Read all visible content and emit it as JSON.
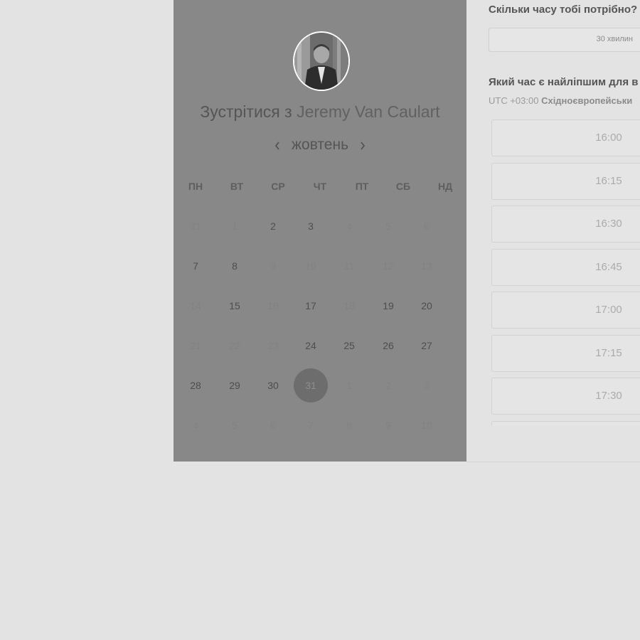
{
  "calendar": {
    "heading_prefix": "Зустрітися з",
    "host_name": "Jeremy Van Caulart",
    "month_label": "жовтень",
    "prev_icon": "chevron-left-icon",
    "next_icon": "chevron-right-icon",
    "weekdays": [
      "ПН",
      "ВТ",
      "СР",
      "ЧТ",
      "ПТ",
      "СБ",
      "НД"
    ],
    "weeks": [
      [
        {
          "d": "31",
          "on": false
        },
        {
          "d": "1",
          "on": false
        },
        {
          "d": "2",
          "on": true
        },
        {
          "d": "3",
          "on": true
        },
        {
          "d": "4",
          "on": false
        },
        {
          "d": "5",
          "on": false
        },
        {
          "d": "6",
          "on": false
        }
      ],
      [
        {
          "d": "7",
          "on": true
        },
        {
          "d": "8",
          "on": true
        },
        {
          "d": "9",
          "on": false
        },
        {
          "d": "10",
          "on": false
        },
        {
          "d": "11",
          "on": false
        },
        {
          "d": "12",
          "on": false
        },
        {
          "d": "13",
          "on": false
        }
      ],
      [
        {
          "d": "14",
          "on": false
        },
        {
          "d": "15",
          "on": true
        },
        {
          "d": "16",
          "on": false
        },
        {
          "d": "17",
          "on": true
        },
        {
          "d": "18",
          "on": false
        },
        {
          "d": "19",
          "on": true
        },
        {
          "d": "20",
          "on": true
        }
      ],
      [
        {
          "d": "21",
          "on": false
        },
        {
          "d": "22",
          "on": false
        },
        {
          "d": "23",
          "on": false
        },
        {
          "d": "24",
          "on": true
        },
        {
          "d": "25",
          "on": true
        },
        {
          "d": "26",
          "on": true
        },
        {
          "d": "27",
          "on": true
        }
      ],
      [
        {
          "d": "28",
          "on": true
        },
        {
          "d": "29",
          "on": true
        },
        {
          "d": "30",
          "on": true
        },
        {
          "d": "31",
          "on": true,
          "selected": true
        },
        {
          "d": "1",
          "on": false
        },
        {
          "d": "2",
          "on": false
        },
        {
          "d": "3",
          "on": false
        }
      ],
      [
        {
          "d": "4",
          "on": false
        },
        {
          "d": "5",
          "on": false
        },
        {
          "d": "6",
          "on": false
        },
        {
          "d": "7",
          "on": false
        },
        {
          "d": "8",
          "on": false
        },
        {
          "d": "9",
          "on": false
        },
        {
          "d": "10",
          "on": false
        }
      ]
    ],
    "selected_day": "31"
  },
  "booking": {
    "duration_question": "Скільки часу тобі потрібно?",
    "duration_value": "30 хвилин",
    "time_question": "Який час є найліпшим для в",
    "timezone_offset": "UTC +03:00",
    "timezone_name": "Східноєвропейськи",
    "slots": [
      "16:00",
      "16:15",
      "16:30",
      "16:45",
      "17:00",
      "17:15",
      "17:30",
      ""
    ]
  }
}
